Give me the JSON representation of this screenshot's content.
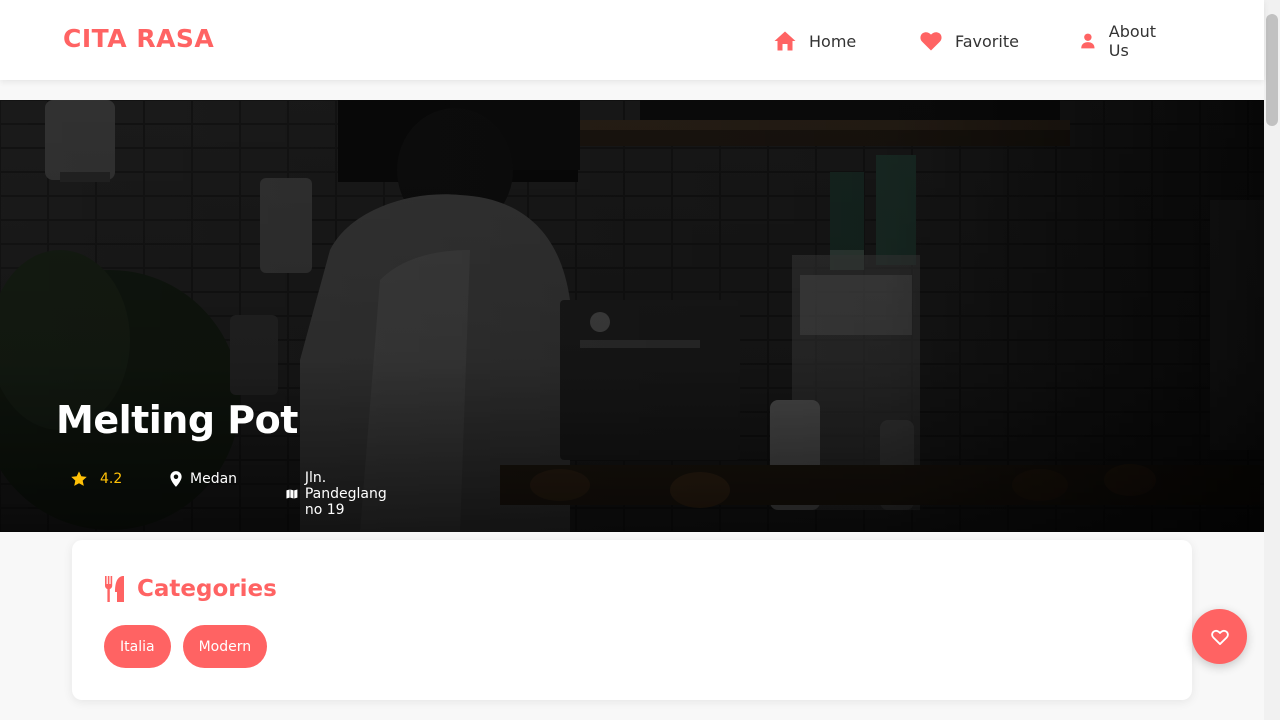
{
  "header": {
    "brand": "CITA RASA",
    "nav": [
      {
        "label": "Home",
        "icon": "home-icon"
      },
      {
        "label": "Favorite",
        "icon": "heart-icon"
      },
      {
        "label": "About Us",
        "icon": "user-icon"
      }
    ]
  },
  "restaurant": {
    "name": "Melting Pot",
    "rating": "4.2",
    "city": "Medan",
    "address": "Jln. Pandeglang no 19",
    "hero_image": "dim photo of a barista working at a cafe counter with white tiled wall and shelves"
  },
  "categories": {
    "title": "Categories",
    "items": [
      "Italia",
      "Modern"
    ]
  },
  "favorite_button": {
    "icon": "heart-outline-icon"
  },
  "colors": {
    "accent": "#ff6363",
    "star": "#ffc107",
    "text": "#333333",
    "background": "#f8f8f8"
  }
}
